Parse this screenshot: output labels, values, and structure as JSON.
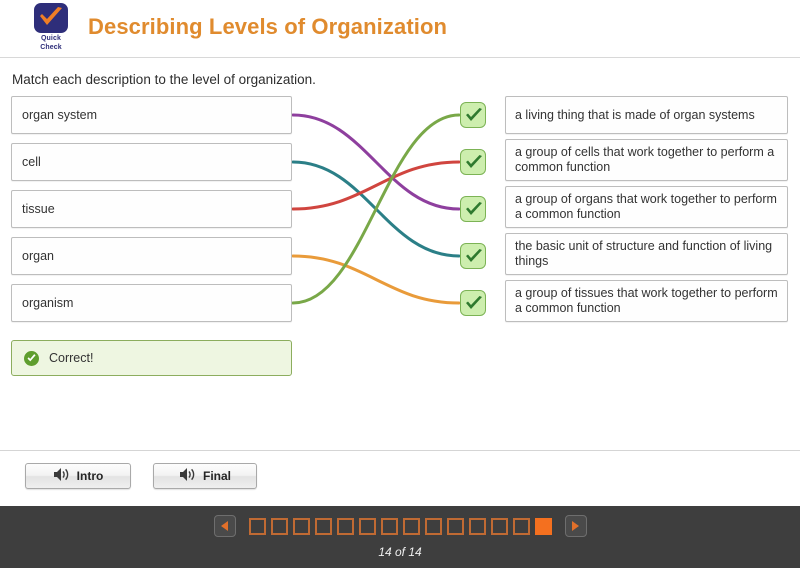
{
  "header": {
    "logo": {
      "icon": "check-badge-icon",
      "line1": "Quick",
      "line2": "Check",
      "badge_color": "#2e2e7a",
      "check_color": "#f07e26"
    },
    "title": "Describing Levels of Organization",
    "title_color": "#e08b2e"
  },
  "main": {
    "instruction": "Match each description to the level of organization.",
    "left_items": [
      {
        "label": "organ system",
        "line_color": "#8e3f9e"
      },
      {
        "label": "cell",
        "line_color": "#2b7f87"
      },
      {
        "label": "tissue",
        "line_color": "#d0453f"
      },
      {
        "label": "organ",
        "line_color": "#e99b3a"
      },
      {
        "label": "organism",
        "line_color": "#79a848"
      }
    ],
    "right_items": [
      {
        "text": "a living thing that is made of organ systems",
        "check": "checkmark-icon"
      },
      {
        "text": "a group of cells that work together to perform a common function",
        "check": "checkmark-icon"
      },
      {
        "text": "a group of organs that work together to perform a common function",
        "check": "checkmark-icon"
      },
      {
        "text": "the basic unit of structure and function of living things",
        "check": "checkmark-icon"
      },
      {
        "text": "a group of tissues that work together to perform a common function",
        "check": "checkmark-icon"
      }
    ],
    "connections": [
      {
        "from": 0,
        "to": 2,
        "color": "#8e3f9e"
      },
      {
        "from": 1,
        "to": 3,
        "color": "#2b7f87"
      },
      {
        "from": 2,
        "to": 1,
        "color": "#d0453f"
      },
      {
        "from": 3,
        "to": 4,
        "color": "#e99b3a"
      },
      {
        "from": 4,
        "to": 0,
        "color": "#79a848"
      }
    ],
    "feedback": {
      "icon": "success-check-icon",
      "text": "Correct!",
      "bg": "#eef6e1",
      "border": "#8cad5e"
    }
  },
  "toolbar": {
    "intro_button": {
      "label": "Intro",
      "icon": "speaker-icon"
    },
    "final_button": {
      "label": "Final",
      "icon": "speaker-icon"
    }
  },
  "footer": {
    "prev_icon": "arrow-left-icon",
    "next_icon": "arrow-right-icon",
    "total_dots": 14,
    "active_dot": 14,
    "page_count": "14 of 14",
    "bg": "#3e3e3e",
    "accent": "#f4701f"
  }
}
